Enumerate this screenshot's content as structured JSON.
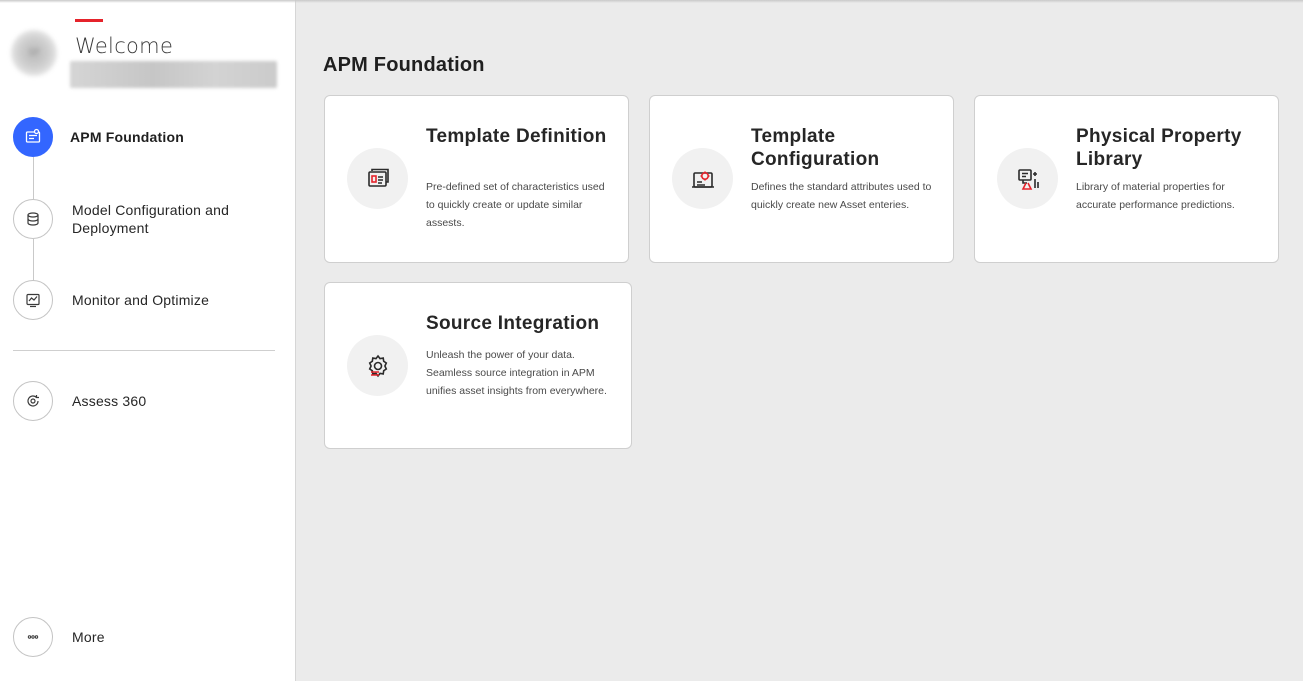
{
  "sidebar": {
    "welcome": "Welcome",
    "avatar_initials": "SP",
    "items": [
      {
        "label": "APM Foundation",
        "icon": "template-icon",
        "active": true
      },
      {
        "label": "Model Configuration and Deployment",
        "icon": "database-icon",
        "active": false
      },
      {
        "label": "Monitor and Optimize",
        "icon": "monitor-icon",
        "active": false
      },
      {
        "label": "Assess 360",
        "icon": "refresh-target-icon",
        "active": false
      }
    ],
    "more": {
      "label": "More",
      "icon": "more-icon"
    }
  },
  "main": {
    "title": "APM Foundation",
    "cards": [
      {
        "title": "Template Definition",
        "description": "Pre-defined set of characteristics used to quickly create or update similar assests.",
        "icon": "template-definition-icon"
      },
      {
        "title": "Template Configuration",
        "description": "Defines the standard attributes used to quickly create new Asset enteries.",
        "icon": "template-configuration-icon"
      },
      {
        "title": "Physical Property Library",
        "description": "Library of material properties for accurate performance predictions.",
        "icon": "physical-property-icon"
      },
      {
        "title": "Source Integration",
        "description": "Unleash the power of your data. Seamless source integration in APM unifies asset insights from everywhere.",
        "icon": "source-integration-icon"
      }
    ]
  },
  "colors": {
    "accent_red": "#e5232b",
    "active_blue": "#3366ff",
    "background": "#ebebeb"
  }
}
